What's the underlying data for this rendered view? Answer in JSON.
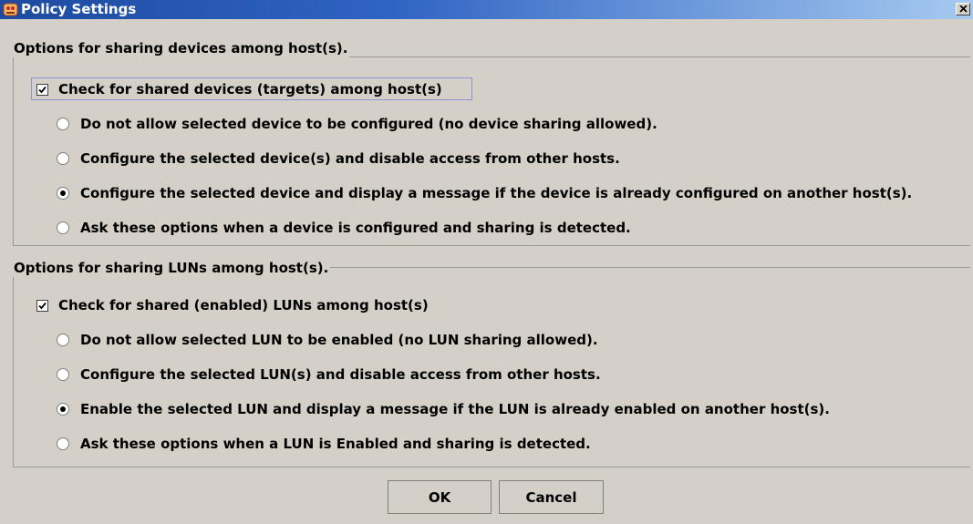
{
  "window": {
    "title": "Policy Settings",
    "close_label": "×"
  },
  "device_group": {
    "legend": "Options for sharing devices among host(s).",
    "checkbox_label": "Check for shared devices (targets) among host(s)",
    "checkbox_checked": true,
    "options": [
      {
        "label": "Do not allow selected device to be configured (no device sharing allowed).",
        "selected": false
      },
      {
        "label": "Configure the selected device(s) and disable access from other hosts.",
        "selected": false
      },
      {
        "label": "Configure the selected device and display a message if the device is already configured on another host(s).",
        "selected": true
      },
      {
        "label": "Ask these options when a device is configured and sharing is detected.",
        "selected": false
      }
    ]
  },
  "lun_group": {
    "legend": "Options for sharing LUNs among host(s).",
    "checkbox_label": "Check for shared (enabled) LUNs among host(s)",
    "checkbox_checked": true,
    "options": [
      {
        "label": "Do not allow selected LUN to be enabled (no LUN sharing allowed).",
        "selected": false
      },
      {
        "label": "Configure the selected LUN(s) and disable access from other hosts.",
        "selected": false
      },
      {
        "label": "Enable the selected LUN and display a message if the LUN is already enabled on another host(s).",
        "selected": true
      },
      {
        "label": "Ask these options when a LUN is Enabled and sharing is detected.",
        "selected": false
      }
    ]
  },
  "buttons": {
    "ok": "OK",
    "cancel": "Cancel"
  },
  "colors": {
    "title_bar": "#1e4ba0",
    "window_bg": "#d4d0c8",
    "group_border": "#9c9a94"
  }
}
